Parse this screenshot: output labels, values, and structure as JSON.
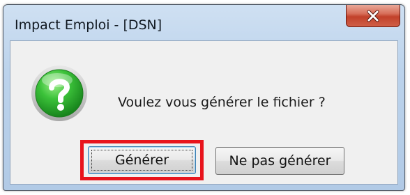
{
  "window": {
    "title": "Impact Emploi - [DSN]"
  },
  "dialog": {
    "icon": "question-icon",
    "message": "Voulez vous générer le fichier ?"
  },
  "buttons": {
    "generate_label": "Générer",
    "skip_label": "Ne pas générer"
  },
  "colors": {
    "highlight_border": "#e8141c",
    "close_button": "#c2412a",
    "icon_green": "#2fb52c"
  }
}
